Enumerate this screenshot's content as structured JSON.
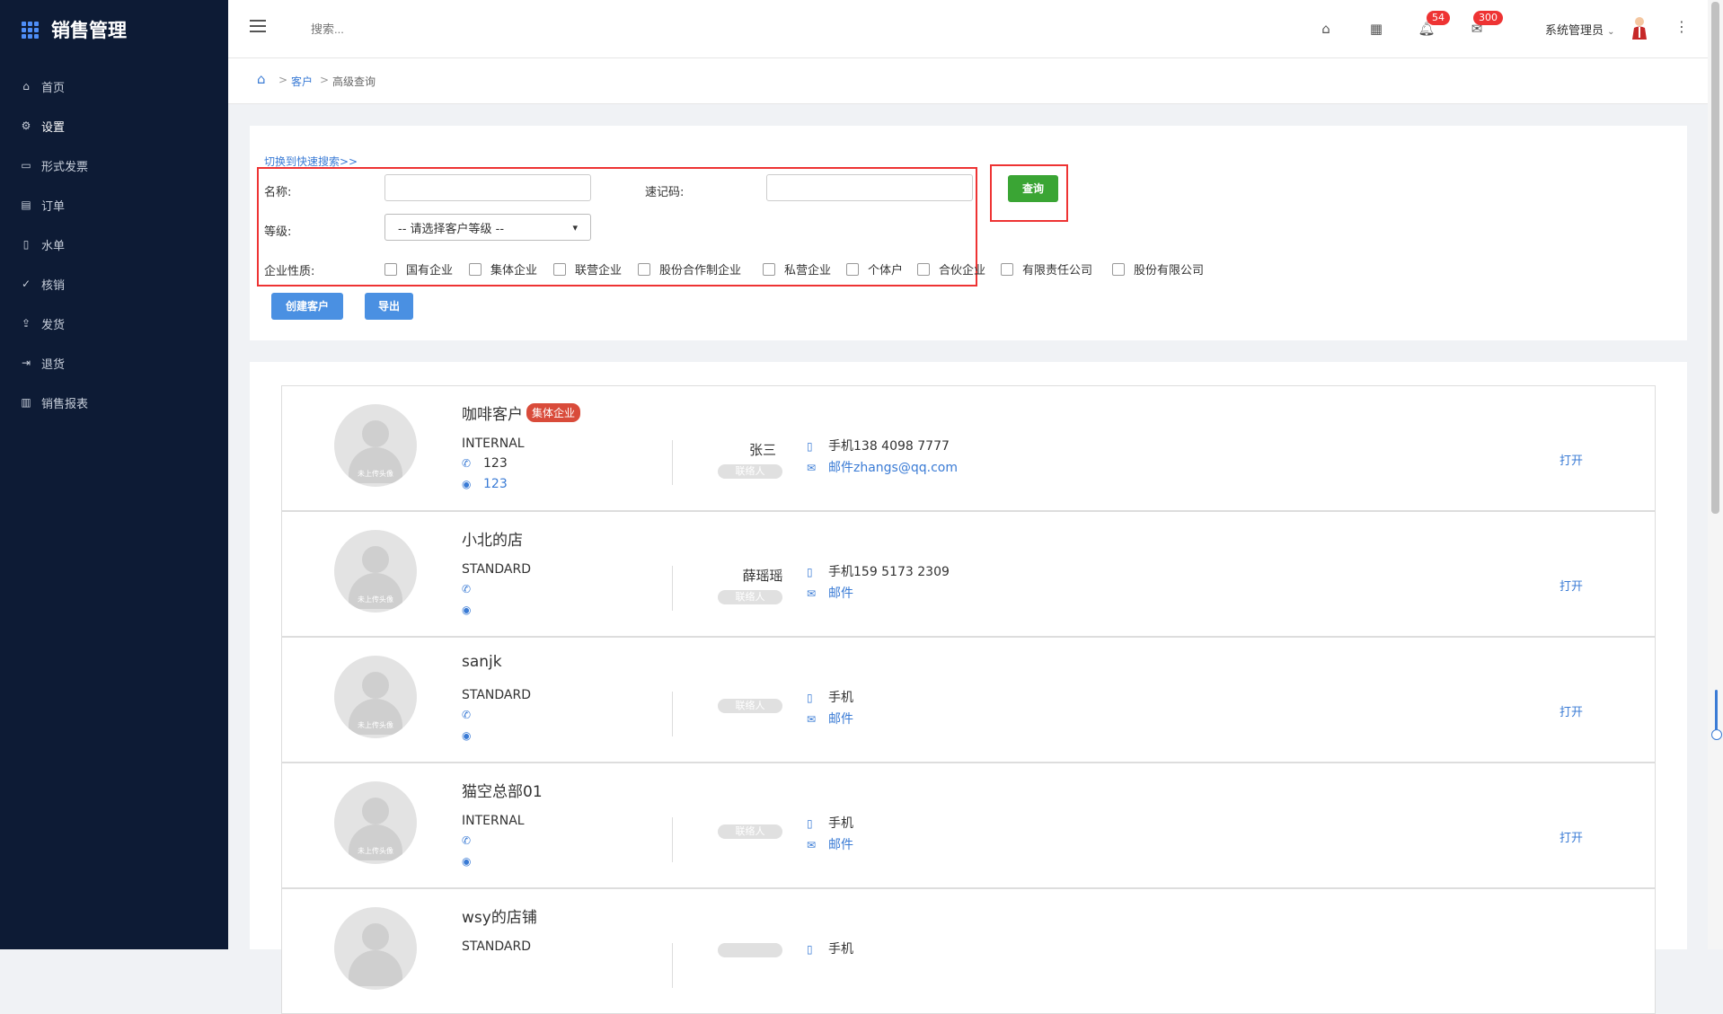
{
  "app": {
    "title": "销售管理"
  },
  "sidebar": {
    "items": [
      {
        "label": "首页",
        "icon": "home-icon"
      },
      {
        "label": "设置",
        "icon": "gear-icon"
      },
      {
        "label": "形式发票",
        "icon": "invoice-icon"
      },
      {
        "label": "订单",
        "icon": "order-icon"
      },
      {
        "label": "水单",
        "icon": "receipt-icon"
      },
      {
        "label": "核销",
        "icon": "check-circle-icon"
      },
      {
        "label": "发货",
        "icon": "upload-icon"
      },
      {
        "label": "退货",
        "icon": "logout-icon"
      },
      {
        "label": "销售报表",
        "icon": "bar-chart-icon"
      }
    ]
  },
  "topbar": {
    "search_placeholder": "搜索...",
    "notifications_badge": "54",
    "messages_badge": "300",
    "user": "系统管理员"
  },
  "breadcrumb": {
    "link": "客户",
    "current": "高级查询"
  },
  "filter": {
    "switch_link": "切换到快速搜索>>",
    "name_label": "名称:",
    "code_label": "速记码:",
    "level_label": "等级:",
    "level_select": "-- 请选择客户等级 --",
    "nature_label": "企业性质:",
    "natures": [
      "国有企业",
      "集体企业",
      "联营企业",
      "股份合作制企业",
      "私营企业",
      "个体户",
      "合伙企业",
      "有限责任公司",
      "股份有限公司"
    ],
    "query_button": "查询",
    "create_button": "创建客户",
    "export_button": "导出"
  },
  "customers": [
    {
      "name": "咖啡客户",
      "tag": "集体企业",
      "level": "INTERNAL",
      "phone": "123",
      "website": "123",
      "contact": "张三",
      "role": "联络人",
      "mobile": "手机138 4098 7777",
      "email": "邮件zhangs@qq.com",
      "open": "打开",
      "avatar_text": "未上传头像"
    },
    {
      "name": "小北的店",
      "tag": "",
      "level": "STANDARD",
      "phone": "",
      "website": "",
      "contact": "薛瑶瑶",
      "role": "联络人",
      "mobile": "手机159 5173 2309",
      "email": "邮件",
      "open": "打开",
      "avatar_text": "未上传头像"
    },
    {
      "name": "sanjk",
      "tag": "",
      "level": "STANDARD",
      "phone": "",
      "website": "",
      "contact": "",
      "role": "联络人",
      "mobile": "手机",
      "email": "邮件",
      "open": "打开",
      "avatar_text": "未上传头像"
    },
    {
      "name": "猫空总部01",
      "tag": "",
      "level": "INTERNAL",
      "phone": "",
      "website": "",
      "contact": "",
      "role": "联络人",
      "mobile": "手机",
      "email": "邮件",
      "open": "打开",
      "avatar_text": "未上传头像"
    },
    {
      "name": "wsy的店铺",
      "tag": "",
      "level": "STANDARD",
      "phone": "",
      "website": "",
      "contact": "",
      "role": "",
      "mobile": "手机",
      "email": "",
      "open": "",
      "avatar_text": ""
    }
  ]
}
